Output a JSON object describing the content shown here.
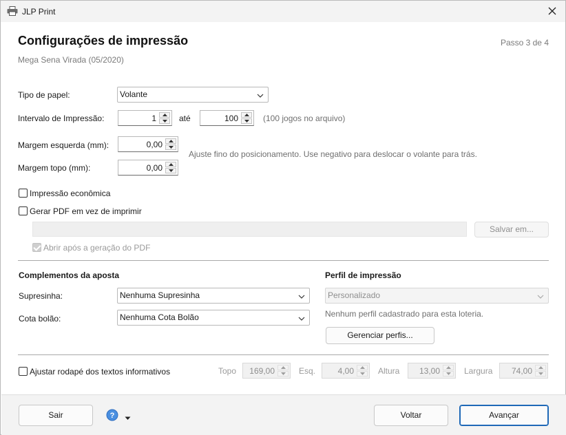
{
  "window": {
    "title": "JLP Print",
    "icons": {
      "app": "printer-icon",
      "close": "close-icon"
    }
  },
  "header": {
    "title": "Configurações de impressão",
    "subtitle": "Mega Sena Virada (05/2020)",
    "step": "Passo 3 de 4"
  },
  "paper": {
    "label": "Tipo de papel:",
    "value": "Volante"
  },
  "interval": {
    "label": "Intervalo de Impressão:",
    "from": "1",
    "to_label": "até",
    "to": "100",
    "note": "(100 jogos no arquivo)"
  },
  "margins": {
    "left_label": "Margem esquerda (mm):",
    "left_value": "0,00",
    "top_label": "Margem topo (mm):",
    "top_value": "0,00",
    "hint": "Ajuste fino do posicionamento. Use negativo para deslocar o volante para trás."
  },
  "options": {
    "economic_label": "Impressão econômica",
    "economic_checked": false,
    "pdf_label": "Gerar PDF em vez de imprimir",
    "pdf_checked": false,
    "pdf_path": "",
    "save_label": "Salvar em...",
    "open_after_label": "Abrir após a geração do PDF",
    "open_after_checked": true
  },
  "complements": {
    "heading": "Complementos da aposta",
    "supresinha_label": "Supresinha:",
    "supresinha_value": "Nenhuma Supresinha",
    "cota_label": "Cota bolão:",
    "cota_value": "Nenhuma Cota Bolão"
  },
  "profile": {
    "heading": "Perfil de impressão",
    "value": "Personalizado",
    "note": "Nenhum perfil cadastrado para esta loteria.",
    "manage_label": "Gerenciar perfis..."
  },
  "footer_texts": {
    "adjust_label": "Ajustar rodapé dos textos informativos",
    "adjust_checked": false,
    "topo_label": "Topo",
    "topo_value": "169,00",
    "esq_label": "Esq.",
    "esq_value": "4,00",
    "altura_label": "Altura",
    "altura_value": "13,00",
    "largura_label": "Largura",
    "largura_value": "74,00"
  },
  "buttons": {
    "exit": "Sair",
    "back": "Voltar",
    "next": "Avançar",
    "help_icon": "help-icon",
    "accent": "#1e68b7"
  }
}
